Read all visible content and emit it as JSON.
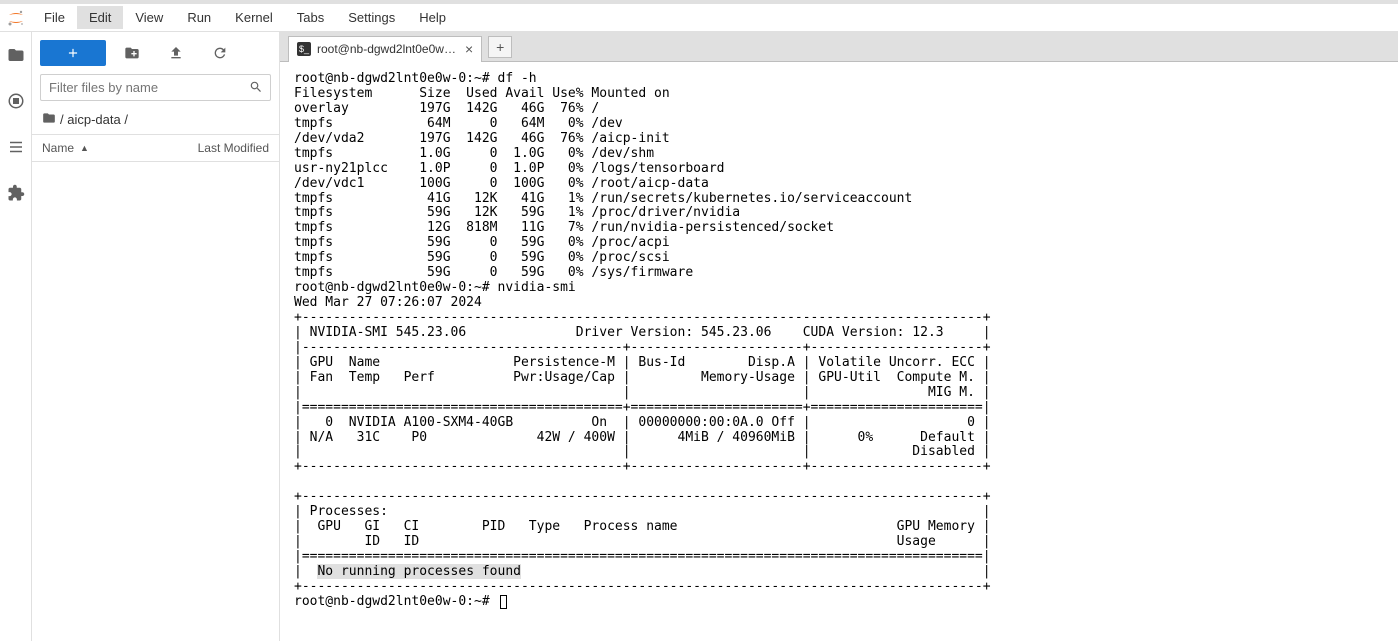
{
  "menubar": {
    "items": [
      "File",
      "Edit",
      "View",
      "Run",
      "Kernel",
      "Tabs",
      "Settings",
      "Help"
    ],
    "active_index": 1
  },
  "sidebar": {
    "filter_placeholder": "Filter files by name",
    "breadcrumb_segments": [
      "/ aicp-data /"
    ],
    "columns": {
      "name": "Name",
      "modified": "Last Modified"
    }
  },
  "tab": {
    "label": "root@nb-dgwd2lnt0e0w-0:"
  },
  "terminal": {
    "prompt1": "root@nb-dgwd2lnt0e0w-0:~# df -h",
    "df_header": "Filesystem      Size  Used Avail Use% Mounted on",
    "df_rows": [
      "overlay         197G  142G   46G  76% /",
      "tmpfs            64M     0   64M   0% /dev",
      "/dev/vda2       197G  142G   46G  76% /aicp-init",
      "tmpfs           1.0G     0  1.0G   0% /dev/shm",
      "usr-ny21plcc    1.0P     0  1.0P   0% /logs/tensorboard",
      "/dev/vdc1       100G     0  100G   0% /root/aicp-data",
      "tmpfs            41G   12K   41G   1% /run/secrets/kubernetes.io/serviceaccount",
      "tmpfs            59G   12K   59G   1% /proc/driver/nvidia",
      "tmpfs            12G  818M   11G   7% /run/nvidia-persistenced/socket",
      "tmpfs            59G     0   59G   0% /proc/acpi",
      "tmpfs            59G     0   59G   0% /proc/scsi",
      "tmpfs            59G     0   59G   0% /sys/firmware"
    ],
    "prompt2": "root@nb-dgwd2lnt0e0w-0:~# nvidia-smi",
    "smi_date": "Wed Mar 27 07:26:07 2024",
    "smi_top_border": "+---------------------------------------------------------------------------------------+",
    "smi_version": "| NVIDIA-SMI 545.23.06              Driver Version: 545.23.06    CUDA Version: 12.3     |",
    "smi_sep": "|-----------------------------------------+----------------------+----------------------+",
    "smi_hdr1": "| GPU  Name                 Persistence-M | Bus-Id        Disp.A | Volatile Uncorr. ECC |",
    "smi_hdr2": "| Fan  Temp   Perf          Pwr:Usage/Cap |         Memory-Usage | GPU-Util  Compute M. |",
    "smi_hdr3": "|                                         |                      |               MIG M. |",
    "smi_eq": "|=========================================+======================+======================|",
    "smi_gpu1": "|   0  NVIDIA A100-SXM4-40GB          On  | 00000000:00:0A.0 Off |                    0 |",
    "smi_gpu2": "| N/A   31C    P0              42W / 400W |      4MiB / 40960MiB |      0%      Default |",
    "smi_gpu3": "|                                         |                      |             Disabled |",
    "smi_bottom": "+-----------------------------------------+----------------------+----------------------+",
    "smi_blank": "",
    "smi_proc_top": "+---------------------------------------------------------------------------------------+",
    "smi_proc_hdr": "| Processes:                                                                            |",
    "smi_proc_cols1": "|  GPU   GI   CI        PID   Type   Process name                            GPU Memory |",
    "smi_proc_cols2": "|        ID   ID                                                             Usage      |",
    "smi_proc_eq": "|=======================================================================================|",
    "smi_proc_none_pre": "|  ",
    "smi_proc_none": "No running processes found",
    "smi_proc_none_post": "                                                           |",
    "smi_proc_bottom": "+---------------------------------------------------------------------------------------+",
    "prompt3": "root@nb-dgwd2lnt0e0w-0:~# "
  }
}
